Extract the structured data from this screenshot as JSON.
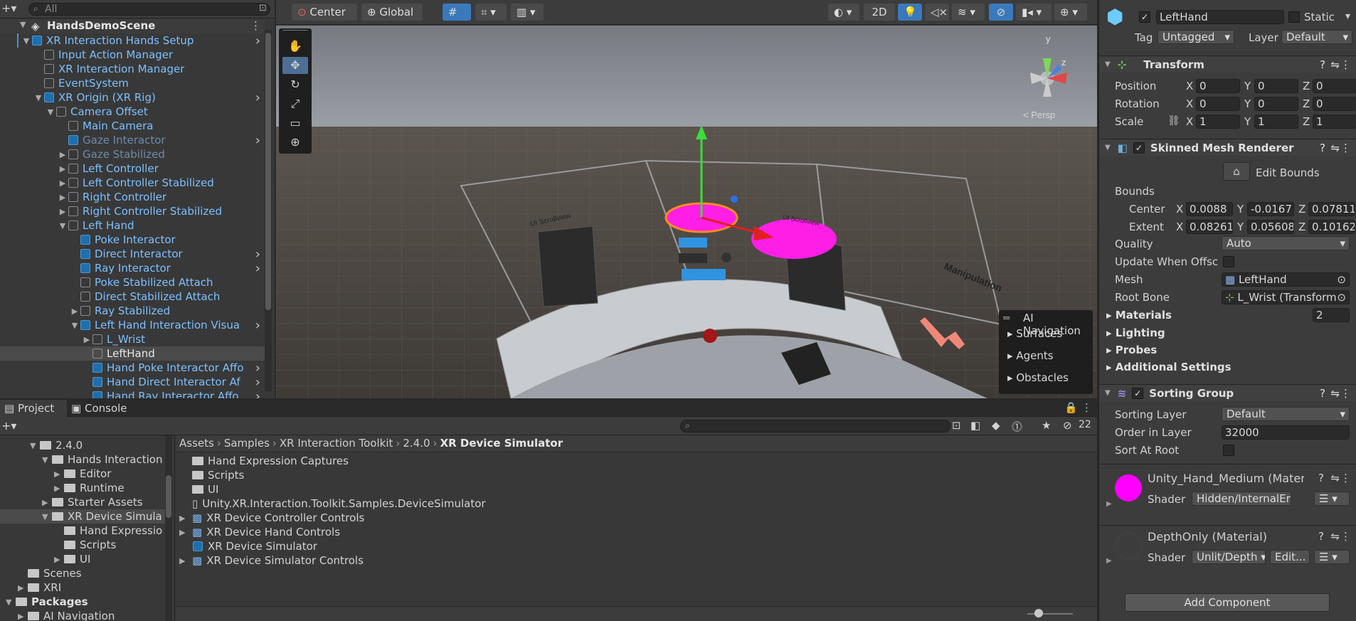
{
  "hierarchy": {
    "search_placeholder": "All",
    "scene_name": "HandsDemoScene",
    "items": [
      {
        "label": "XR Interaction Hands Setup",
        "depth": 1,
        "arrow": "▼",
        "style": "blue",
        "icon": "blue",
        "more": true
      },
      {
        "label": "Input Action Manager",
        "depth": 2,
        "arrow": "",
        "style": "blue",
        "icon": "gray"
      },
      {
        "label": "XR Interaction Manager",
        "depth": 2,
        "arrow": "",
        "style": "blue",
        "icon": "gray"
      },
      {
        "label": "EventSystem",
        "depth": 2,
        "arrow": "",
        "style": "blue",
        "icon": "gray"
      },
      {
        "label": "XR Origin (XR Rig)",
        "depth": 2,
        "arrow": "▼",
        "style": "blue",
        "icon": "blue",
        "more": true
      },
      {
        "label": "Camera Offset",
        "depth": 3,
        "arrow": "▼",
        "style": "blue",
        "icon": "gray"
      },
      {
        "label": "Main Camera",
        "depth": 4,
        "arrow": "",
        "style": "blue",
        "icon": "gray"
      },
      {
        "label": "Gaze Interactor",
        "depth": 4,
        "arrow": "",
        "style": "dim",
        "icon": "blue",
        "more": true
      },
      {
        "label": "Gaze Stabilized",
        "depth": 4,
        "arrow": "▶",
        "style": "dim",
        "icon": "gray"
      },
      {
        "label": "Left Controller",
        "depth": 4,
        "arrow": "▶",
        "style": "blue",
        "icon": "gray"
      },
      {
        "label": "Left Controller Stabilized",
        "depth": 4,
        "arrow": "▶",
        "style": "blue",
        "icon": "gray"
      },
      {
        "label": "Right Controller",
        "depth": 4,
        "arrow": "▶",
        "style": "blue",
        "icon": "gray"
      },
      {
        "label": "Right Controller Stabilized",
        "depth": 4,
        "arrow": "▶",
        "style": "blue",
        "icon": "gray"
      },
      {
        "label": "Left Hand",
        "depth": 4,
        "arrow": "▼",
        "style": "blue",
        "icon": "gray"
      },
      {
        "label": "Poke Interactor",
        "depth": 5,
        "arrow": "",
        "style": "blue",
        "icon": "blue"
      },
      {
        "label": "Direct Interactor",
        "depth": 5,
        "arrow": "",
        "style": "blue",
        "icon": "blue",
        "more": true
      },
      {
        "label": "Ray Interactor",
        "depth": 5,
        "arrow": "",
        "style": "blue",
        "icon": "blue",
        "more": true
      },
      {
        "label": "Poke Stabilized Attach",
        "depth": 5,
        "arrow": "",
        "style": "blue",
        "icon": "gray"
      },
      {
        "label": "Direct Stabilized Attach",
        "depth": 5,
        "arrow": "",
        "style": "blue",
        "icon": "gray"
      },
      {
        "label": "Ray Stabilized",
        "depth": 5,
        "arrow": "▶",
        "style": "blue",
        "icon": "gray"
      },
      {
        "label": "Left Hand Interaction Visua",
        "depth": 5,
        "arrow": "▼",
        "style": "blue",
        "icon": "blue",
        "more": true
      },
      {
        "label": "L_Wrist",
        "depth": 6,
        "arrow": "▶",
        "style": "blue",
        "icon": "gray"
      },
      {
        "label": "LeftHand",
        "depth": 6,
        "arrow": "",
        "style": "white",
        "icon": "gray",
        "selected": true
      },
      {
        "label": "Hand Poke Interactor Affo",
        "depth": 6,
        "arrow": "",
        "style": "blue",
        "icon": "blue",
        "more": true
      },
      {
        "label": "Hand Direct Interactor Af",
        "depth": 6,
        "arrow": "",
        "style": "blue",
        "icon": "blue",
        "more": true
      },
      {
        "label": "Hand Ray Interactor Affo",
        "depth": 6,
        "arrow": "",
        "style": "blue",
        "icon": "blue",
        "more": true
      }
    ]
  },
  "scene_toolbar": {
    "pivot": "Center",
    "space": "Global",
    "mode_2d": "2D"
  },
  "scene": {
    "persp_label": "< Persp",
    "gizmo_y": "y",
    "gizmo_z": "z",
    "label_manipulation": "Manipulation",
    "label_ui_scrollview": "UI Scrollview",
    "label_ui_scrollview2": "UI Scrollview",
    "ai_nav": {
      "title": "AI Navigation",
      "items": [
        "Surfaces",
        "Agents",
        "Obstacles"
      ]
    }
  },
  "inspector": {
    "object_name": "LeftHand",
    "static_label": "Static",
    "tag_label": "Tag",
    "tag_value": "Untagged",
    "layer_label": "Layer",
    "layer_value": "Default",
    "transform": {
      "title": "Transform",
      "position_label": "Position",
      "rotation_label": "Rotation",
      "scale_label": "Scale",
      "position": [
        "0",
        "0",
        "0"
      ],
      "rotation": [
        "0",
        "0",
        "0"
      ],
      "scale": [
        "1",
        "1",
        "1"
      ]
    },
    "smr": {
      "title": "Skinned Mesh Renderer",
      "edit_bounds": "Edit Bounds",
      "bounds_label": "Bounds",
      "center_label": "Center",
      "extent_label": "Extent",
      "center": [
        "0.0088",
        "-0.0167",
        "0.07811"
      ],
      "extent": [
        "0.08261",
        "0.05608",
        "0.10162"
      ],
      "quality_label": "Quality",
      "quality_value": "Auto",
      "update_offscreen_label": "Update When Offscre",
      "mesh_label": "Mesh",
      "mesh_value": "LeftHand",
      "root_bone_label": "Root Bone",
      "root_bone_value": "L_Wrist (Transform)",
      "materials_label": "Materials",
      "materials_count": "2",
      "lighting_label": "Lighting",
      "probes_label": "Probes",
      "additional_label": "Additional Settings"
    },
    "sorting": {
      "title": "Sorting Group",
      "sorting_layer_label": "Sorting Layer",
      "sorting_layer_value": "Default",
      "order_label": "Order in Layer",
      "order_value": "32000",
      "sort_at_root_label": "Sort At Root"
    },
    "material1": {
      "name": "Unity_Hand_Medium (Materi",
      "shader_label": "Shader",
      "shader_value": "Hidden/InternalError"
    },
    "material2": {
      "name": "DepthOnly (Material)",
      "shader_label": "Shader",
      "shader_value": "Unlit/Depth",
      "edit_label": "Edit..."
    },
    "add_component": "Add Component"
  },
  "project": {
    "tab_project": "Project",
    "tab_console": "Console",
    "hidden_count": "22",
    "tree": [
      {
        "label": "2.4.0",
        "depth": 2,
        "arrow": "▼"
      },
      {
        "label": "Hands Interaction",
        "depth": 3,
        "arrow": "▼"
      },
      {
        "label": "Editor",
        "depth": 4,
        "arrow": "▶"
      },
      {
        "label": "Runtime",
        "depth": 4,
        "arrow": "▶"
      },
      {
        "label": "Starter Assets",
        "depth": 3,
        "arrow": "▶"
      },
      {
        "label": "XR Device Simula",
        "depth": 3,
        "arrow": "▼",
        "selected": true
      },
      {
        "label": "Hand Expressio",
        "depth": 4,
        "arrow": ""
      },
      {
        "label": "Scripts",
        "depth": 4,
        "arrow": ""
      },
      {
        "label": "UI",
        "depth": 4,
        "arrow": "▶"
      },
      {
        "label": "Scenes",
        "depth": 1,
        "arrow": ""
      },
      {
        "label": "XRI",
        "depth": 1,
        "arrow": "▶"
      },
      {
        "label": "Packages",
        "depth": 0,
        "arrow": "▼",
        "bold": true
      },
      {
        "label": "AI Navigation",
        "depth": 1,
        "arrow": "▶"
      }
    ],
    "breadcrumb": [
      "Assets",
      "Samples",
      "XR Interaction Toolkit",
      "2.4.0",
      "XR Device Simulator"
    ],
    "files": [
      {
        "label": "Hand Expression Captures",
        "kind": "folder",
        "arrow": ""
      },
      {
        "label": "Scripts",
        "kind": "folder",
        "arrow": ""
      },
      {
        "label": "UI",
        "kind": "folder",
        "arrow": ""
      },
      {
        "label": "Unity.XR.Interaction.Toolkit.Samples.DeviceSimulator",
        "kind": "asm",
        "arrow": ""
      },
      {
        "label": "XR Device Controller Controls",
        "kind": "input",
        "arrow": "▶"
      },
      {
        "label": "XR Device Hand Controls",
        "kind": "input",
        "arrow": "▶"
      },
      {
        "label": "XR Device Simulator",
        "kind": "prefab",
        "arrow": ""
      },
      {
        "label": "XR Device Simulator Controls",
        "kind": "input",
        "arrow": "▶"
      }
    ]
  }
}
